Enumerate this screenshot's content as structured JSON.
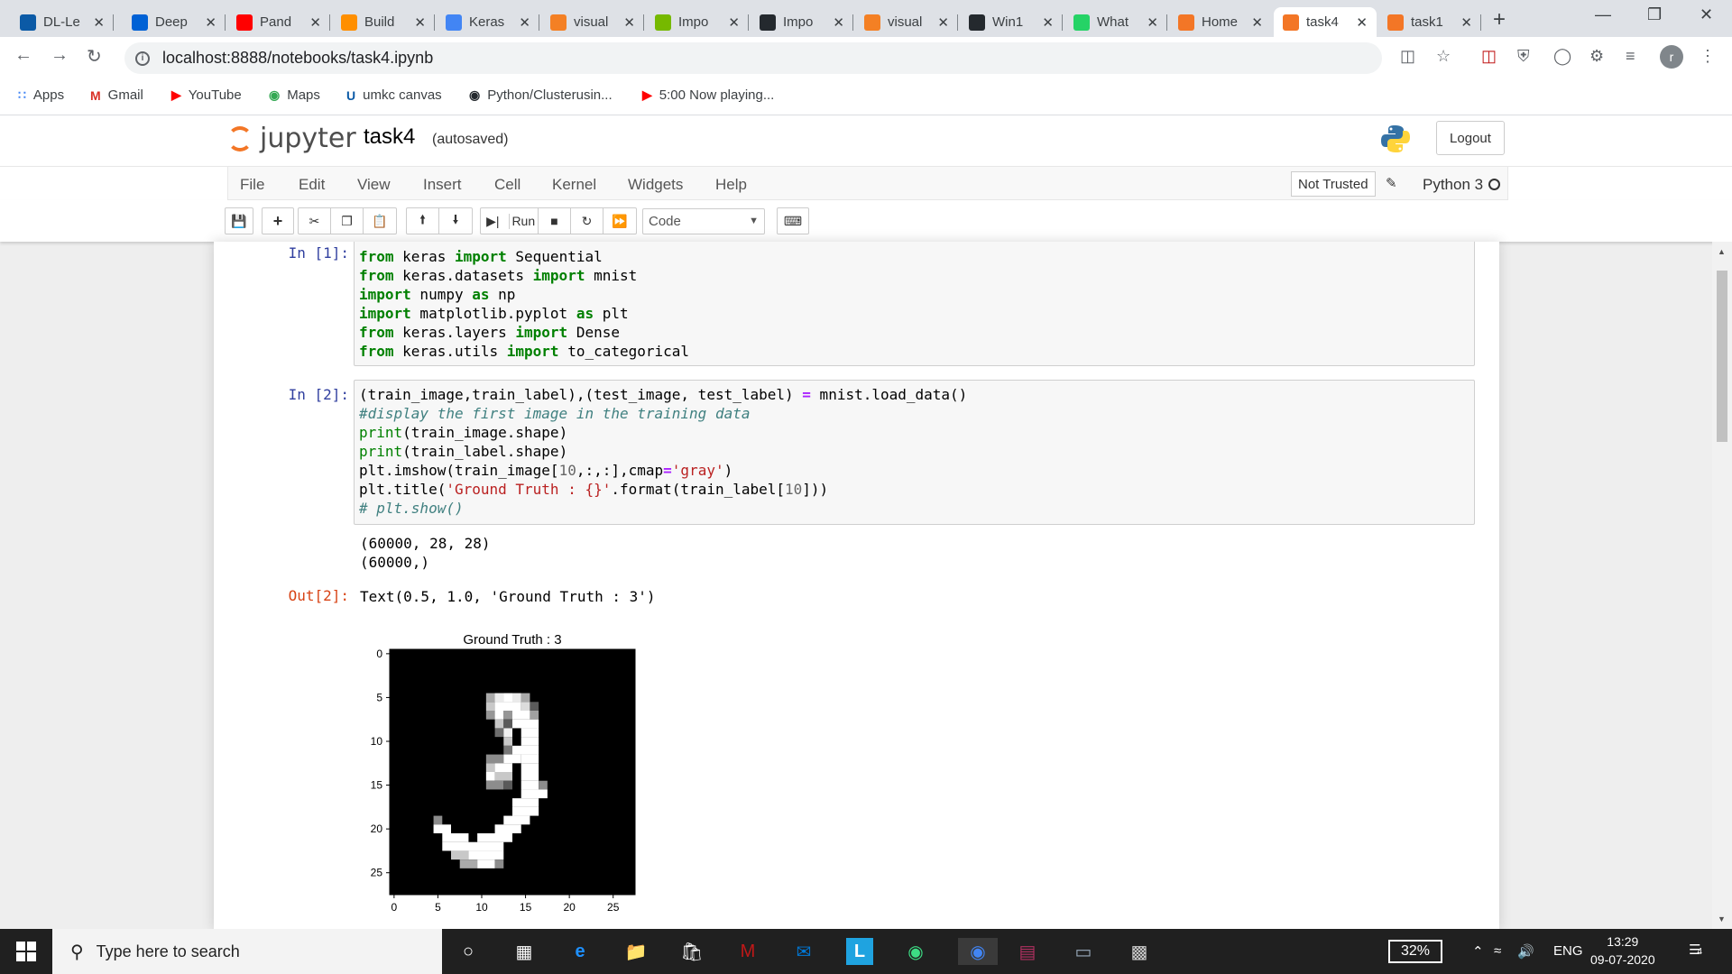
{
  "tabs": [
    {
      "label": "DL-Le",
      "icon": "umkc-icon",
      "color": "#0b5aa6"
    },
    {
      "label": "Deep",
      "icon": "box-icon",
      "color": "#0061d5"
    },
    {
      "label": "Pand",
      "icon": "youtube-icon",
      "color": "#ff0000"
    },
    {
      "label": "Build",
      "icon": "tensorflow-icon",
      "color": "#ff8f00"
    },
    {
      "label": "Keras",
      "icon": "google-icon",
      "color": "#4285f4"
    },
    {
      "label": "visual",
      "icon": "stackoverflow-icon",
      "color": "#f48024"
    },
    {
      "label": "Impo",
      "icon": "nvidia-icon",
      "color": "#76b900"
    },
    {
      "label": "Impo",
      "icon": "github-icon",
      "color": "#24292e"
    },
    {
      "label": "visual",
      "icon": "stackoverflow-icon",
      "color": "#f48024"
    },
    {
      "label": "Win1",
      "icon": "github-icon",
      "color": "#24292e"
    },
    {
      "label": "What",
      "icon": "whatsapp-icon",
      "color": "#25d366"
    },
    {
      "label": "Home",
      "icon": "jupyter-icon",
      "color": "#f37626"
    },
    {
      "label": "task4",
      "icon": "jupyter-notebook-icon",
      "color": "#f37626"
    },
    {
      "label": "task1",
      "icon": "jupyter-notebook-icon",
      "color": "#f37626"
    }
  ],
  "url": "localhost:8888/notebooks/task4.ipynb",
  "bookmarks": [
    {
      "label": "Apps"
    },
    {
      "label": "Gmail"
    },
    {
      "label": "YouTube"
    },
    {
      "label": "Maps"
    },
    {
      "label": "umkc canvas"
    },
    {
      "label": "Python/Clusterusin..."
    },
    {
      "label": "5:00 Now playing..."
    }
  ],
  "jupyter": {
    "logo_text": "jupyter",
    "notebook_name": "task4",
    "save_status": "(autosaved)",
    "logout": "Logout",
    "menu": [
      "File",
      "Edit",
      "View",
      "Insert",
      "Cell",
      "Kernel",
      "Widgets",
      "Help"
    ],
    "trust": "Not Trusted",
    "kernel": "Python 3",
    "run_label": "Run",
    "cell_type": "Code"
  },
  "cells": {
    "c1_prompt": "In [1]:",
    "c2_prompt": "In [2]:",
    "out2_prompt": "Out[2]:",
    "stdout": [
      "(60000, 28, 28)",
      "(60000,)"
    ],
    "out2_value": "Text(0.5, 1.0, 'Ground Truth : 3')"
  },
  "chart_data": {
    "type": "heatmap",
    "title": "Ground Truth : 3",
    "xticks": [
      "0",
      "5",
      "10",
      "15",
      "20",
      "25"
    ],
    "yticks": [
      "0",
      "5",
      "10",
      "15",
      "20",
      "25"
    ],
    "cmap": "gray",
    "grid": "off",
    "size": [
      28,
      28
    ]
  },
  "taskbar": {
    "search_placeholder": "Type here to search",
    "battery": "32%",
    "lang": "ENG",
    "time": "13:29",
    "date": "09-07-2020",
    "notif": "4"
  }
}
